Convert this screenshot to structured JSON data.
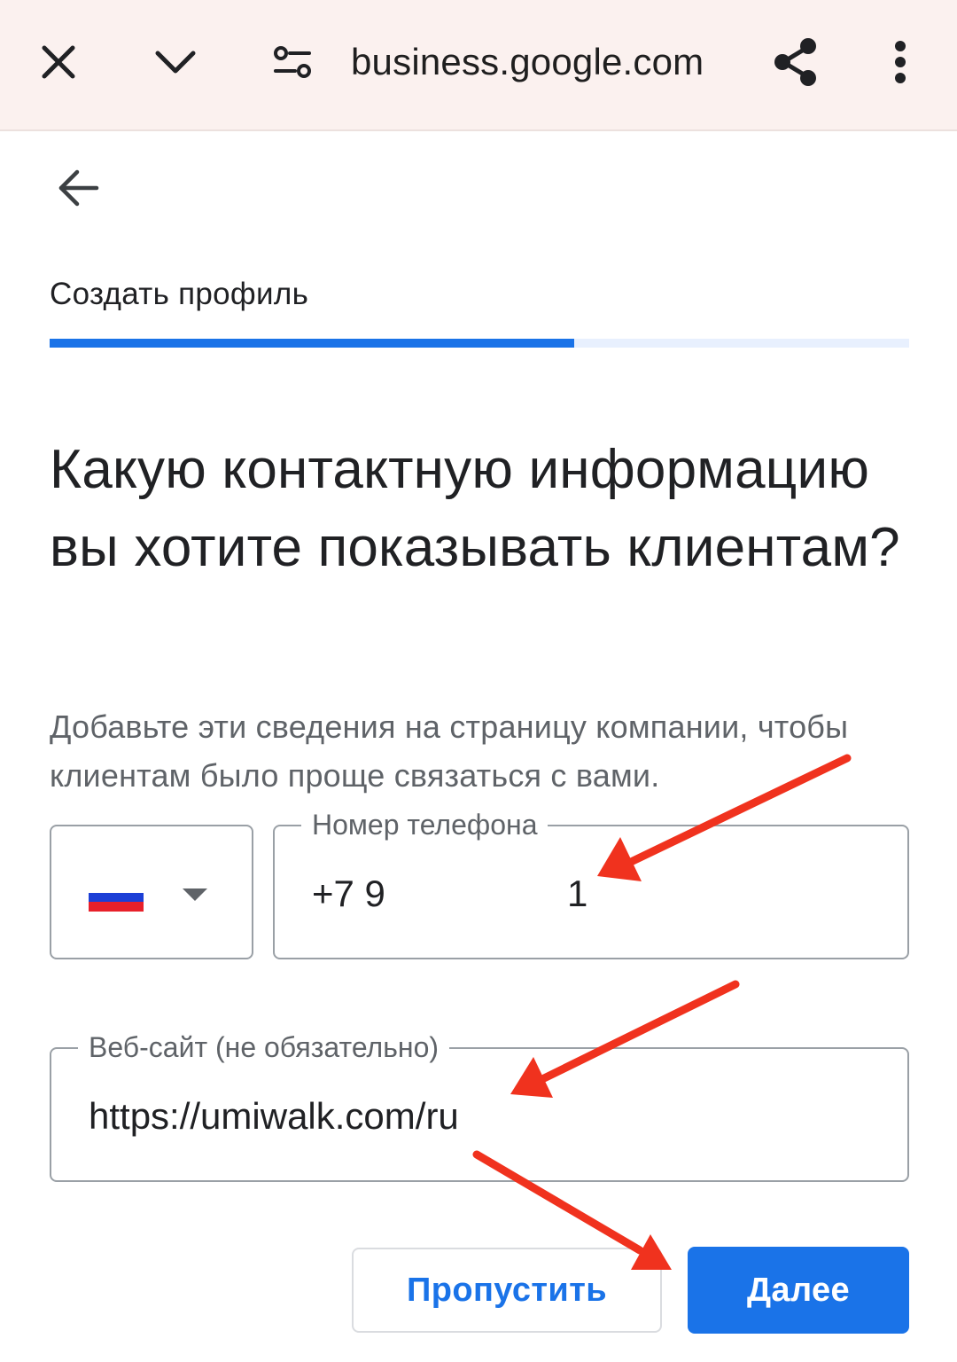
{
  "browser": {
    "url": "business.google.com",
    "icons": {
      "close": "close-icon",
      "collapse": "chevron-down-icon",
      "site_settings": "site-settings-icon",
      "share": "share-icon",
      "more": "more-vert-icon"
    }
  },
  "nav": {
    "back_icon": "arrow-back-icon"
  },
  "step": {
    "title": "Создать профиль",
    "progress_fraction": 0.61
  },
  "heading": "Какую контактную информацию вы хотите показывать клиентам?",
  "subtext": "Добавьте эти сведения на страницу компании, чтобы клиентам было проще связаться с вами.",
  "country": {
    "flag": "russia-flag",
    "flag_colors": [
      "#ffffff",
      "#1c3fd6",
      "#e8202a"
    ]
  },
  "phone": {
    "label": "Номер телефона",
    "value_prefix": "+7 9",
    "value_end": "1"
  },
  "website": {
    "label": "Веб-сайт (не обязательно)",
    "value": "https://umiwalk.com/ru"
  },
  "buttons": {
    "skip": "Пропустить",
    "next": "Далее"
  },
  "colors": {
    "accent": "#1a73e8",
    "annotation": "#f0321e",
    "toolbar_bg": "#fbf1ef"
  }
}
